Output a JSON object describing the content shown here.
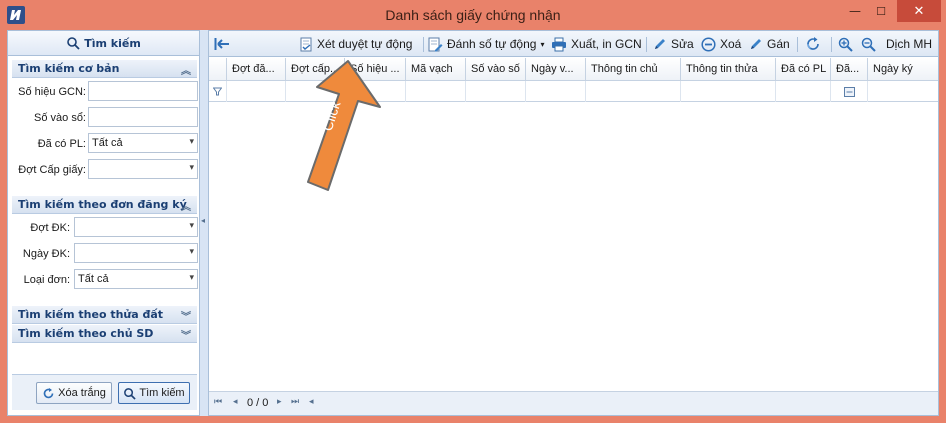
{
  "window": {
    "title": "Danh sách giấy chứng nhận",
    "minimize": "—",
    "maximize": "☐",
    "close": "✕"
  },
  "left_panel": {
    "header": "Tìm kiếm",
    "basic": {
      "title": "Tìm kiếm cơ bản",
      "so_hieu_label": "Số hiệu GCN:",
      "so_hieu_value": "",
      "so_vao_so_label": "Số vào sổ:",
      "so_vao_so_value": "",
      "da_co_pl_label": "Đã có PL:",
      "da_co_pl_value": "Tất cả",
      "dot_cap_label": "Đợt Cấp giấy:",
      "dot_cap_value": ""
    },
    "registration": {
      "title": "Tìm kiếm theo đơn đăng ký",
      "dot_dk_label": "Đợt ĐK:",
      "dot_dk_value": "",
      "ngay_dk_label": "Ngày ĐK:",
      "ngay_dk_value": "",
      "loai_don_label": "Loại đơn:",
      "loai_don_value": "Tất cả"
    },
    "parcel_title": "Tìm kiếm theo thửa đất",
    "owner_title": "Tìm kiếm theo chủ SD",
    "clear_button": "Xóa trắng",
    "search_button": "Tìm kiếm"
  },
  "toolbar": {
    "approve": "Xét duyệt tự động",
    "numbering": "Đánh số tự động",
    "export": "Xuất, in GCN",
    "edit": "Sửa",
    "delete": "Xoá",
    "assign": "Gán",
    "view": "Dịch MH"
  },
  "grid": {
    "columns": [
      "Đợt đă...",
      "Đợt cấp...",
      "Số hiệu ...",
      "Mã vạch",
      "Số vào số",
      "Ngày v...",
      "Thông tin chủ",
      "Thông tin thửa",
      "Đã có PL",
      "Đã...",
      "Ngày ký"
    ],
    "pager": "0 / 0"
  },
  "annotation": {
    "text": "Click",
    "color": "#ef8a3c"
  },
  "colors": {
    "frame": "#e9826a",
    "close": "#c74b3a",
    "panel": "#d8e4f4",
    "accent": "#1b3f73"
  }
}
